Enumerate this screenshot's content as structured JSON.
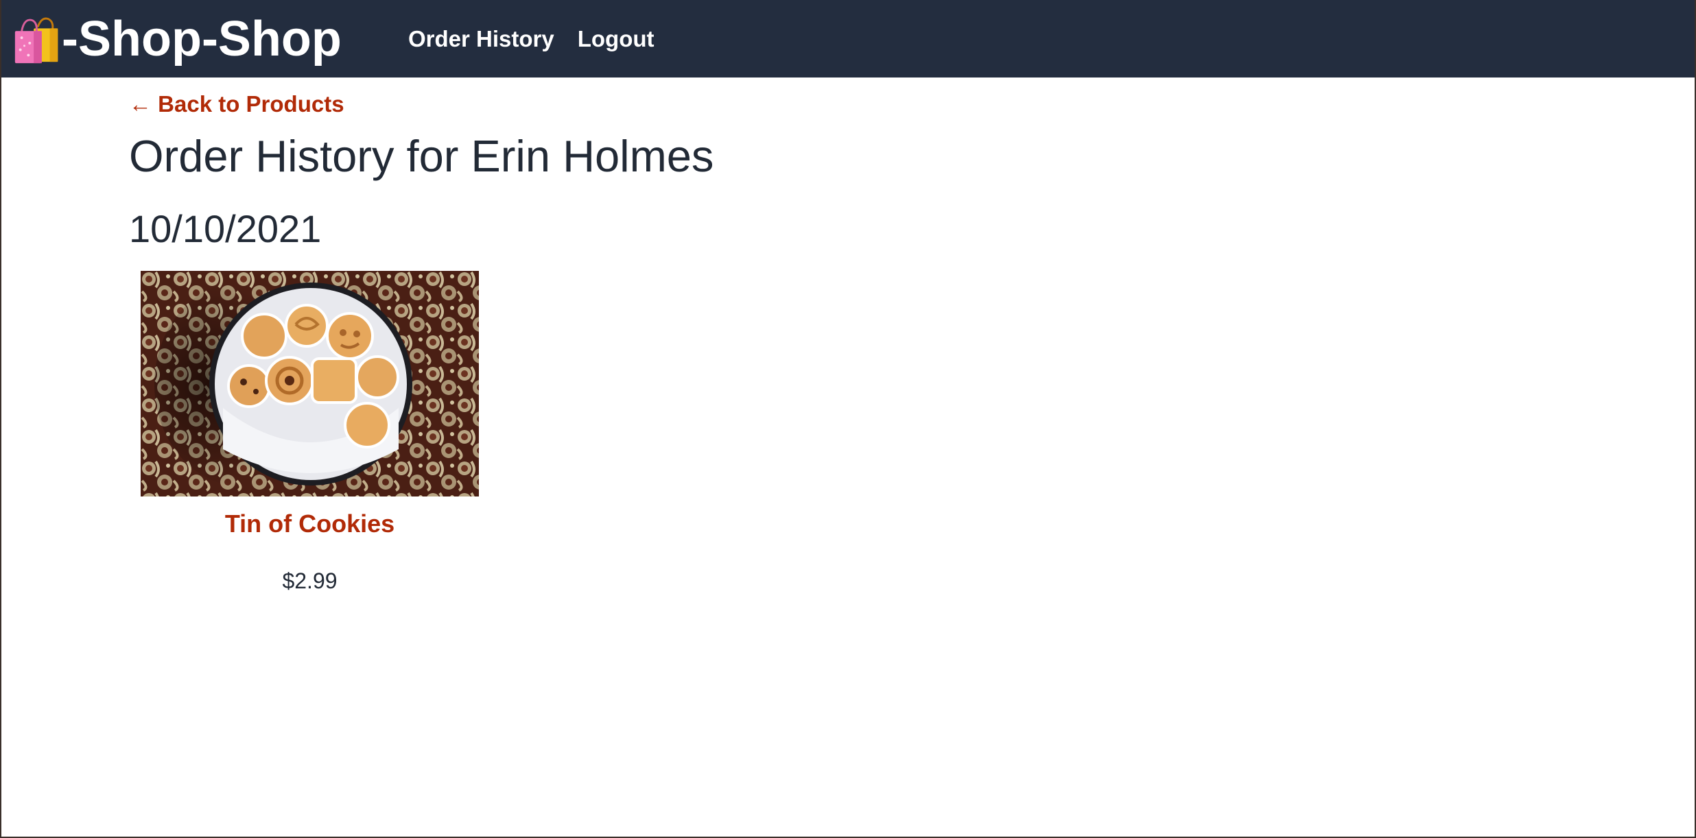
{
  "header": {
    "brand_emoji": "shopping-bags-icon",
    "brand_text": "-Shop-Shop",
    "nav": [
      {
        "label": "Order History"
      },
      {
        "label": "Logout"
      }
    ]
  },
  "main": {
    "back_link": "← Back to Products",
    "title": "Order History for Erin Holmes",
    "orders": [
      {
        "date": "10/10/2021",
        "products": [
          {
            "name": "Tin of Cookies",
            "price": "$2.99",
            "image": "cookie-tin-image"
          }
        ]
      }
    ]
  },
  "colors": {
    "navbar": "#232d3f",
    "accent": "#b12a07",
    "text": "#222a36"
  }
}
